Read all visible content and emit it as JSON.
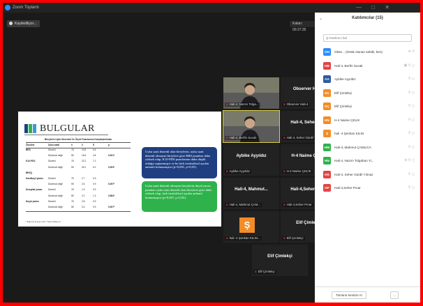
{
  "window": {
    "title": "Zoom Toplantı",
    "controls": [
      "—",
      "□",
      "✕"
    ]
  },
  "recording": {
    "label": "Kaydediliyor..."
  },
  "view_badge": {
    "label": "Kalan: 00:27:35"
  },
  "slide": {
    "heading": "BULGULAR",
    "bar_colors": [
      "#1f3f80",
      "#2fb24c",
      "#3a9ad9"
    ],
    "table_caption": "Bireylerin Uyku Düzenleri ile Ölçek Puanlarının Karşılaştırılması",
    "table_headers": [
      "Ölçekler",
      "Uyku saati",
      "n",
      "x̄",
      "S",
      "p"
    ],
    "table_rows": [
      [
        "BRS",
        "Düzenli",
        "78",
        "19.8",
        "5.6",
        ""
      ],
      [
        "",
        "Düzensiz değil",
        "55",
        "15.6",
        "4.8",
        "0,001*"
      ],
      [
        "K10-PDS",
        "Düzenli",
        "78",
        "22.2",
        "7.2",
        ""
      ],
      [
        "",
        "Düzensiz değil",
        "55",
        "26.1",
        "6.2",
        "0,003*"
      ],
      [
        "BESQ",
        "",
        "",
        "",
        "",
        ""
      ],
      [
        "Kaslikçiyi yarası",
        "Düzenli",
        "78",
        "2.7",
        "0.9",
        ""
      ],
      [
        "",
        "Düzensiz değil",
        "55",
        "2.6",
        "0.9",
        "0,057*"
      ],
      [
        "Dısspital yarası",
        "Düzenli",
        "78",
        "1.9",
        "0.9",
        ""
      ],
      [
        "",
        "Düzensiz değil",
        "55",
        "2.2",
        "1.3",
        "0,564*"
      ],
      [
        "Duyal yarası",
        "Düzenli",
        "78",
        "2.8",
        "0.9",
        ""
      ],
      [
        "",
        "Düzensiz değil",
        "55",
        "3.3",
        "0.9",
        "0,007*"
      ]
    ],
    "table_note": "* Bağımsız iki grup t testi; ** Mann-Whitney U",
    "box1_text": "Uyku saati düzenli olan bireylerin, uyku saati düzenli olmayan bireylere göre BRS puanları daha yüksek olup, K10-PDS puanlarının daha düşük olduğu saptanmıştır ve bu fark istatistiksel açıdan anlamlı bulunmuştur (p=0,001, p=0,05).",
    "box2_text": "Uyku saati düzenli olmayan bireylerin duyal yarası puanları uyku saati düzenli olan bireylere göre daha yüksek olup, fark istatistiksel açıdan anlamlı bulunmuştur (p=0,007, p<0,05)."
  },
  "tiles": [
    {
      "type": "video",
      "label": "Hali-4, Nazım Tolga..."
    },
    {
      "type": "name",
      "center": "Observer Hali-4",
      "label": "Observer Hali-4"
    },
    {
      "type": "video",
      "label": "Hali-4, Berfin Sucak"
    },
    {
      "type": "name",
      "center": "Hali-4, Seher Gü...",
      "label": "Hali-4, Seher Gürdil Y..."
    },
    {
      "type": "name",
      "center": "Aybike Ayyıldız",
      "label": "Aybike Ayyıldız"
    },
    {
      "type": "name",
      "center": "H-4 Naime ÇELİK",
      "label": "H-4 Naime ÇELİK"
    },
    {
      "type": "name",
      "center": "Hali-4, Mahmut...",
      "label": "Hali-4, Mahmut ÇAM..."
    },
    {
      "type": "name",
      "center": "Hali-4,Seher Pınar",
      "label": "Hali-4,Seher Pınar"
    },
    {
      "type": "avatar",
      "avatar": "Ş",
      "label": "hali -4 Şenkan KILIN..."
    },
    {
      "type": "name",
      "center": "Elif Çimlekçi",
      "label": "Elif Çimlekçi"
    },
    {
      "type": "name",
      "center": "Elif Çimlekçi",
      "label": "Elif Çimlekçi"
    }
  ],
  "panel": {
    "title": "Katılımcılar (15)",
    "search_placeholder": "Q Katılımcı bul",
    "participants": [
      {
        "initials": "OH",
        "color": "#2d8cff",
        "name": "Obse... (Ortak olunan sahibi, ben)",
        "icons": "⊕ ⚲"
      },
      {
        "initials": "HB",
        "color": "#e34444",
        "name": "Hali-4, Berfin Sucak",
        "icons": "▣ ⚲ ◻"
      },
      {
        "initials": "AA",
        "color": "#2d5aa0",
        "name": "Aybike Ayyıldız",
        "icons": "⚲ ◻"
      },
      {
        "initials": "EÇ",
        "color": "#f28c28",
        "name": "Elif Çimlekçi",
        "icons": "⚲ ◻"
      },
      {
        "initials": "EÇ",
        "color": "#f28c28",
        "name": "Elif Çimlekçi",
        "icons": "⚲ ◻"
      },
      {
        "initials": "HN",
        "color": "#f28c28",
        "name": "H-4 Naime ÇELİK",
        "icons": "⚲ ◻"
      },
      {
        "initials": "Ş",
        "color": "#f28c28",
        "name": "hali -4 Şenkan KILIN",
        "icons": "⚲ ◻"
      },
      {
        "initials": "HM",
        "color": "#2fb24c",
        "name": "Hali-4, Mahmut ÇAMLICA",
        "icons": "⚲ ◻"
      },
      {
        "initials": "HN",
        "color": "#2fb24c",
        "name": "Hali-4, Nazım Tolgahan Yi...",
        "icons": "⊕ ⚲ ◻"
      },
      {
        "initials": "HS",
        "color": "#e34444",
        "name": "Hali-4, Seher Gürdil Yılmaz",
        "icons": "⚲ ◻"
      },
      {
        "initials": "HP",
        "color": "#e34444",
        "name": "Hali-4,Seher Pınar",
        "icons": "⚲ ◻"
      }
    ],
    "footer_button": "Tümünü Sessize Al",
    "footer_more": "..."
  }
}
